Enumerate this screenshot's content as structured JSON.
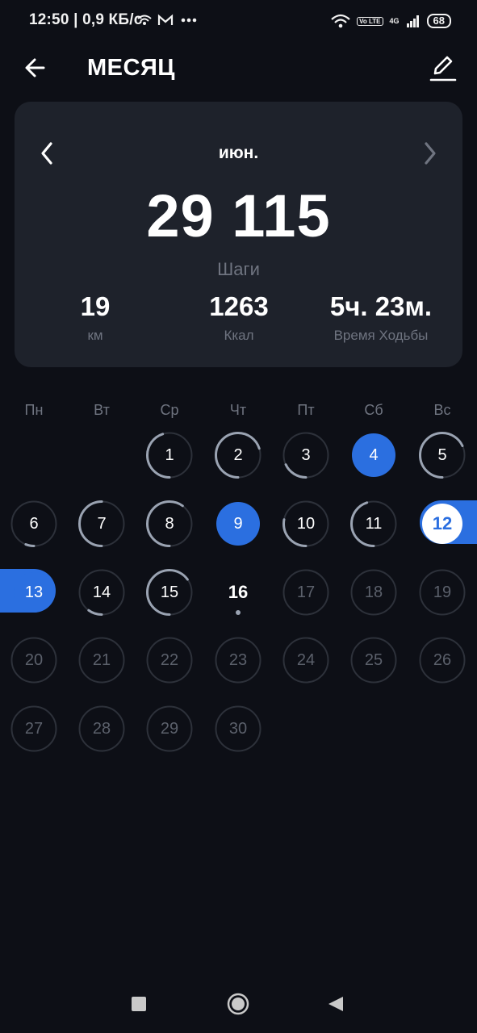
{
  "status_bar": {
    "left": "12:50 | 0,9 КБ/с",
    "battery": "68",
    "volte": "Vo LTE",
    "network": "4G"
  },
  "header": {
    "title": "МЕСЯЦ"
  },
  "summary": {
    "month": "июн.",
    "steps": "29 115",
    "steps_label": "Шаги",
    "distance": "19",
    "distance_label": "км",
    "calories": "1263",
    "calories_label": "Ккал",
    "walk_time": "5ч. 23м.",
    "walk_time_label": "Время Ходьбы"
  },
  "calendar": {
    "weekdays": [
      "Пн",
      "Вт",
      "Ср",
      "Чт",
      "Пт",
      "Сб",
      "Вс"
    ],
    "first_weekday_index": 2,
    "today": 16,
    "selected": [
      12,
      13
    ],
    "days": [
      {
        "d": 1,
        "progress": 0.45
      },
      {
        "d": 2,
        "progress": 0.7
      },
      {
        "d": 3,
        "progress": 0.18
      },
      {
        "d": 4,
        "progress": 1.0
      },
      {
        "d": 5,
        "progress": 0.68
      },
      {
        "d": 6,
        "progress": 0.06
      },
      {
        "d": 7,
        "progress": 0.5
      },
      {
        "d": 8,
        "progress": 0.6
      },
      {
        "d": 9,
        "progress": 1.0
      },
      {
        "d": 10,
        "progress": 0.28
      },
      {
        "d": 11,
        "progress": 0.45
      },
      {
        "d": 12,
        "progress": 1.0
      },
      {
        "d": 13,
        "progress": 1.0
      },
      {
        "d": 14,
        "progress": 0.1
      },
      {
        "d": 15,
        "progress": 0.65
      },
      {
        "d": 16,
        "progress": 0.0
      },
      {
        "d": 17,
        "progress": 0
      },
      {
        "d": 18,
        "progress": 0
      },
      {
        "d": 19,
        "progress": 0
      },
      {
        "d": 20,
        "progress": 0
      },
      {
        "d": 21,
        "progress": 0
      },
      {
        "d": 22,
        "progress": 0
      },
      {
        "d": 23,
        "progress": 0
      },
      {
        "d": 24,
        "progress": 0
      },
      {
        "d": 25,
        "progress": 0
      },
      {
        "d": 26,
        "progress": 0
      },
      {
        "d": 27,
        "progress": 0
      },
      {
        "d": 28,
        "progress": 0
      },
      {
        "d": 29,
        "progress": 0
      },
      {
        "d": 30,
        "progress": 0
      }
    ]
  },
  "colors": {
    "accent": "#2b6fe0",
    "ring_progress": "#9aa3b2",
    "ring_track": "#2d313a",
    "future_text": "#5b606b"
  }
}
